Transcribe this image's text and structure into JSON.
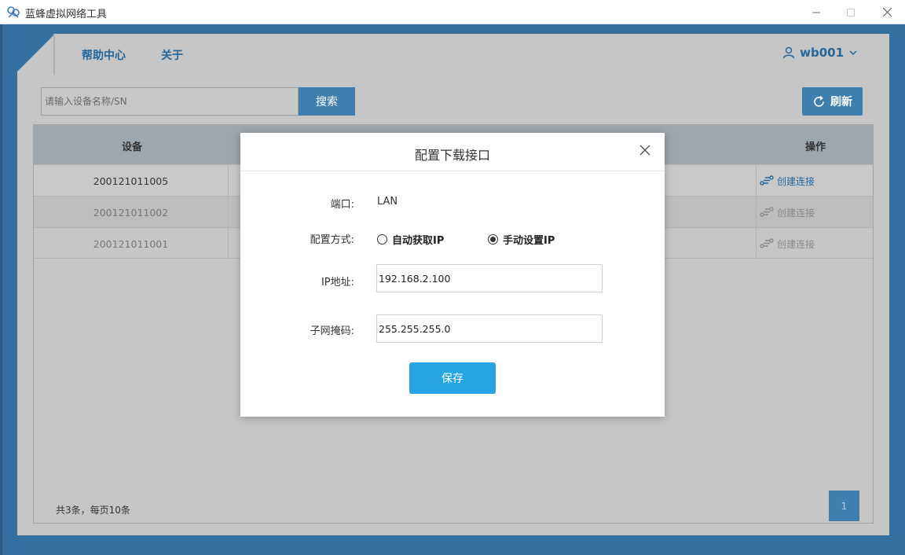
{
  "window": {
    "title": "蓝蜂虚拟网络工具",
    "app_icon": "bee-logo-icon",
    "controls": [
      "minimize-icon",
      "maximize-icon",
      "close-icon"
    ]
  },
  "nav": {
    "help": "帮助中心",
    "about": "关于",
    "user": "wb001"
  },
  "toolbar": {
    "search_placeholder": "请输入设备名称/SN",
    "search_label": "搜索",
    "refresh_label": "刷新"
  },
  "table": {
    "headers": {
      "device": "设备",
      "action": "操作"
    },
    "rows": [
      {
        "device": "200121011005",
        "action": "创建连接",
        "enabled": true
      },
      {
        "device": "200121011002",
        "action": "创建连接",
        "enabled": false
      },
      {
        "device": "200121011001",
        "action": "创建连接",
        "enabled": false
      }
    ],
    "summary": "共3条，每页10条",
    "page": "1"
  },
  "modal": {
    "title": "配置下载接口",
    "port_label": "端口:",
    "port_value": "LAN",
    "mode_label": "配置方式:",
    "mode_auto": "自动获取IP",
    "mode_manual": "手动设置IP",
    "mode_selected": "manual",
    "ip_label": "IP地址:",
    "ip_value": "192.168.2.100",
    "mask_label": "子网掩码:",
    "mask_value": "255.255.255.0",
    "save_label": "保存"
  },
  "colors": {
    "frame": "#336f9f",
    "accent": "#25a4e5",
    "link": "#24669a",
    "button_dim": "#3f7fb0"
  }
}
